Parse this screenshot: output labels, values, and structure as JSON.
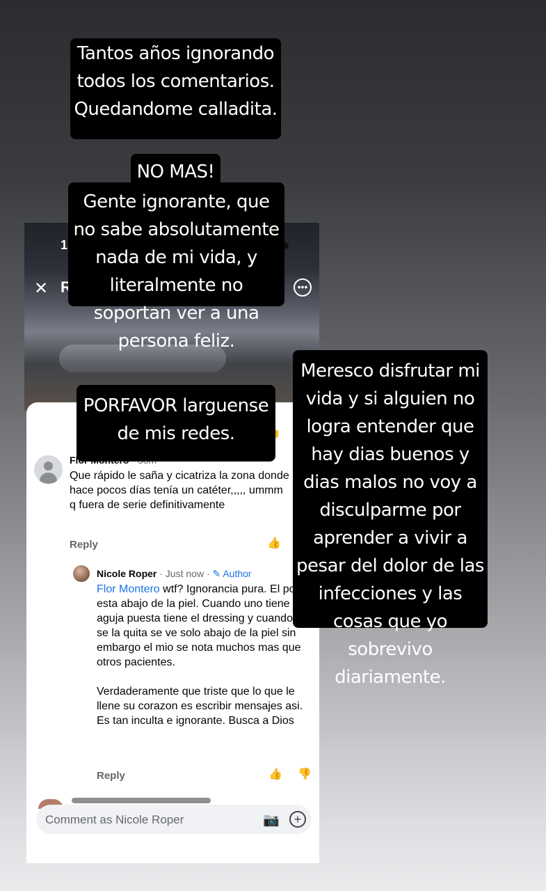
{
  "story": {
    "text1": "Tantos años ignorando todos los comentarios. Quedandome calladita.",
    "text2": "NO MAS!",
    "text3": "Gente ignorante, que no sabe absolutamente nada de mi vida, y literalmente no soportan ver a una persona feliz.",
    "text4": "PORFAVOR  larguense de mis redes.",
    "text5": "Meresco disfrutar mi vida y si alguien no logra entender que hay dias buenos y dias malos no voy a disculparme por aprender a vivir a pesar del dolor de las infecciones y las cosas que yo sobrevivo diariamente."
  },
  "screenshot": {
    "header": {
      "status_time": "1",
      "title": "Ree",
      "close_icon": "close-icon",
      "search_icon": "search-icon",
      "more_icon": "more-icon"
    },
    "top_reply_label": "Re",
    "comments": [
      {
        "author": "Flor Montero",
        "time": "· 38m",
        "text": "Que rápido le saña y cicatriza la zona donde hace pocos días tenía un catéter,,,,, ummm q fuera de serie definitivamente",
        "reply_label": "Reply"
      },
      {
        "author": "Nicole Roper",
        "time": "· Just now ·",
        "badge": "✎ Author",
        "mention": "Flor Montero",
        "text": " wtf? Ignorancia pura. El port esta abajo de la piel. Cuando uno tiene la aguja puesta tiene el dressing y cuando uno se la quita se ve solo abajo de la piel sin embargo el mio se nota muchos mas que otros pacientes.\n\nVerdaderamente que triste que lo que le llene su corazon es escribir mensajes asi. Es tan inculta e ignorante. Busca a Dios",
        "reply_label": "Reply"
      }
    ],
    "composer": {
      "placeholder": "Comment as Nicole Roper"
    }
  }
}
